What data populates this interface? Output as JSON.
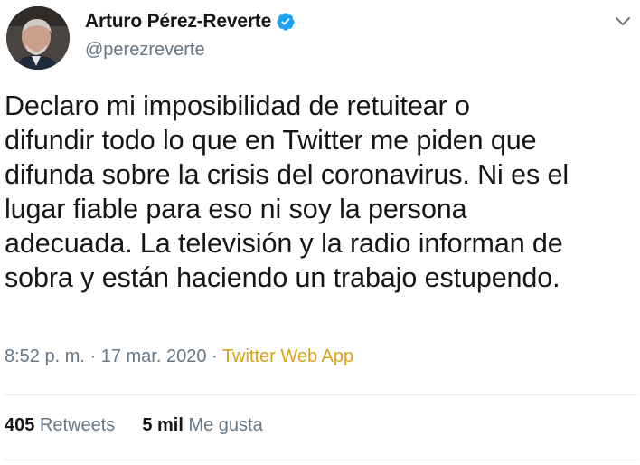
{
  "author": {
    "display_name": "Arturo Pérez-Reverte",
    "handle": "@perezreverte",
    "verified": true,
    "avatar_icon": "avatar"
  },
  "tweet": {
    "text": "Declaro mi imposibilidad de retuitear o\ndifundir todo lo que en Twitter me piden que\ndifunda sobre la crisis del coronavirus. Ni es el\nlugar fiable para eso ni soy la persona\nadecuada. La televisión y la radio informan de\nsobra y están haciendo un trabajo estupendo.",
    "time": "8:52 p. m.",
    "separator": " · ",
    "date": "17 mar. 2020",
    "source": "Twitter Web App"
  },
  "stats": {
    "retweets_count": "405",
    "retweets_label": "Retweets",
    "likes_count": "5 mil",
    "likes_label": "Me gusta"
  },
  "colors": {
    "verified_badge": "#1da1f2",
    "source_link": "#d9a11a",
    "muted_text": "#657786"
  },
  "icons": {
    "verified": "verified-badge-icon",
    "menu": "chevron-down-icon"
  }
}
